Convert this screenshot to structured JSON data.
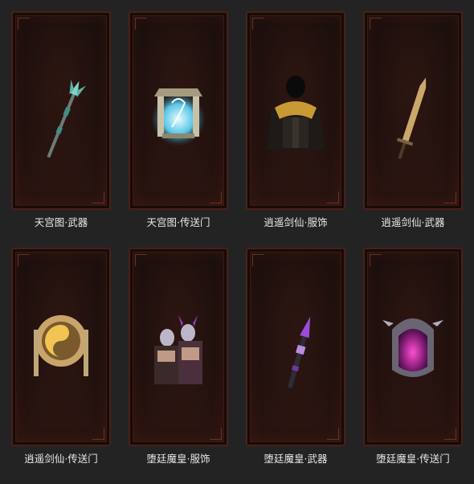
{
  "items": [
    {
      "label": "天宫图·武器",
      "icon": "spear-icon"
    },
    {
      "label": "天宫图·传送门",
      "icon": "portal-gate-icon"
    },
    {
      "label": "逍遥剑仙·服饰",
      "icon": "hooded-robe-icon"
    },
    {
      "label": "逍遥剑仙·武器",
      "icon": "sword-icon"
    },
    {
      "label": "逍遥剑仙·传送门",
      "icon": "taiji-portal-icon"
    },
    {
      "label": "堕廷魔皇·服饰",
      "icon": "demon-outfit-icon"
    },
    {
      "label": "堕廷魔皇·武器",
      "icon": "demon-spear-icon"
    },
    {
      "label": "堕廷魔皇·传送门",
      "icon": "demon-portal-icon"
    }
  ]
}
